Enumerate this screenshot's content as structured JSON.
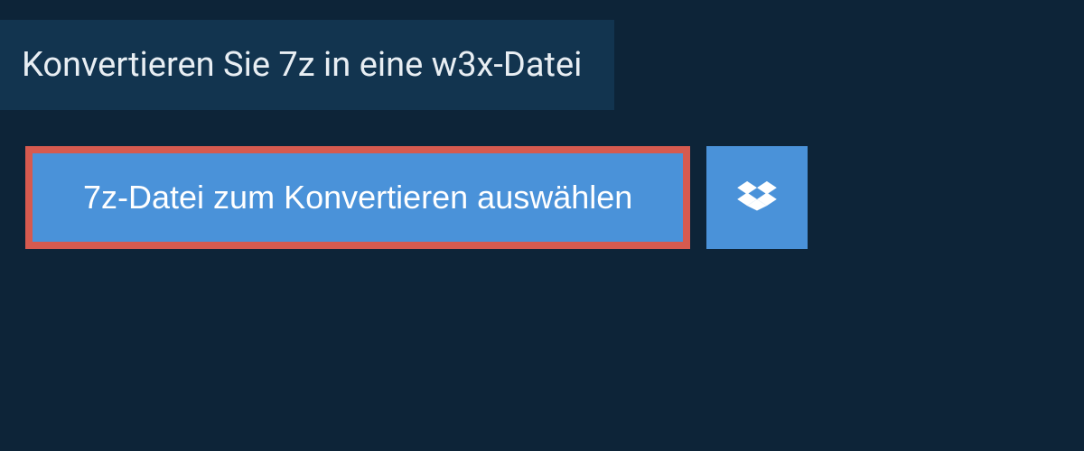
{
  "header": {
    "title": "Konvertieren Sie 7z in eine w3x-Datei"
  },
  "actions": {
    "select_file_label": "7z-Datei zum Konvertieren auswählen"
  }
}
